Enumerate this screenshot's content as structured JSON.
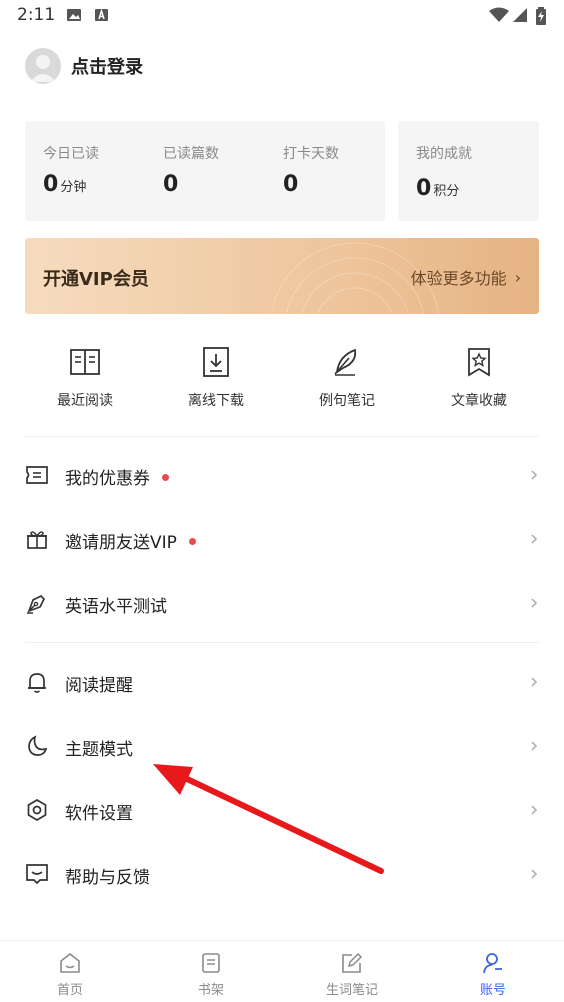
{
  "status_bar": {
    "time": "2:11"
  },
  "profile": {
    "login_text": "点击登录"
  },
  "stats": {
    "today_read": {
      "label": "今日已读",
      "value": "0",
      "unit": "分钟"
    },
    "articles_read": {
      "label": "已读篇数",
      "value": "0"
    },
    "checkin_days": {
      "label": "打卡天数",
      "value": "0"
    },
    "achievements": {
      "label": "我的成就",
      "value": "0",
      "unit": "积分"
    }
  },
  "vip": {
    "title": "开通VIP会员",
    "cta": "体验更多功能"
  },
  "quick_actions": [
    {
      "label": "最近阅读",
      "icon": "book-open-icon"
    },
    {
      "label": "离线下载",
      "icon": "download-icon"
    },
    {
      "label": "例句笔记",
      "icon": "feather-icon"
    },
    {
      "label": "文章收藏",
      "icon": "bookmark-star-icon"
    }
  ],
  "menu": {
    "coupons": "我的优惠券",
    "invite": "邀请朋友送VIP",
    "english_test": "英语水平测试",
    "reminder": "阅读提醒",
    "theme": "主题模式",
    "settings": "软件设置",
    "help": "帮助与反馈"
  },
  "tabs": [
    {
      "label": "首页",
      "icon": "home-icon"
    },
    {
      "label": "书架",
      "icon": "bookshelf-icon"
    },
    {
      "label": "生词笔记",
      "icon": "edit-note-icon"
    },
    {
      "label": "账号",
      "icon": "account-icon",
      "active": true
    }
  ],
  "colors": {
    "accent": "#3d63e8",
    "badge": "#e74c4c",
    "vip_gold": "#e6b383",
    "annotation_arrow": "#e8191b"
  }
}
